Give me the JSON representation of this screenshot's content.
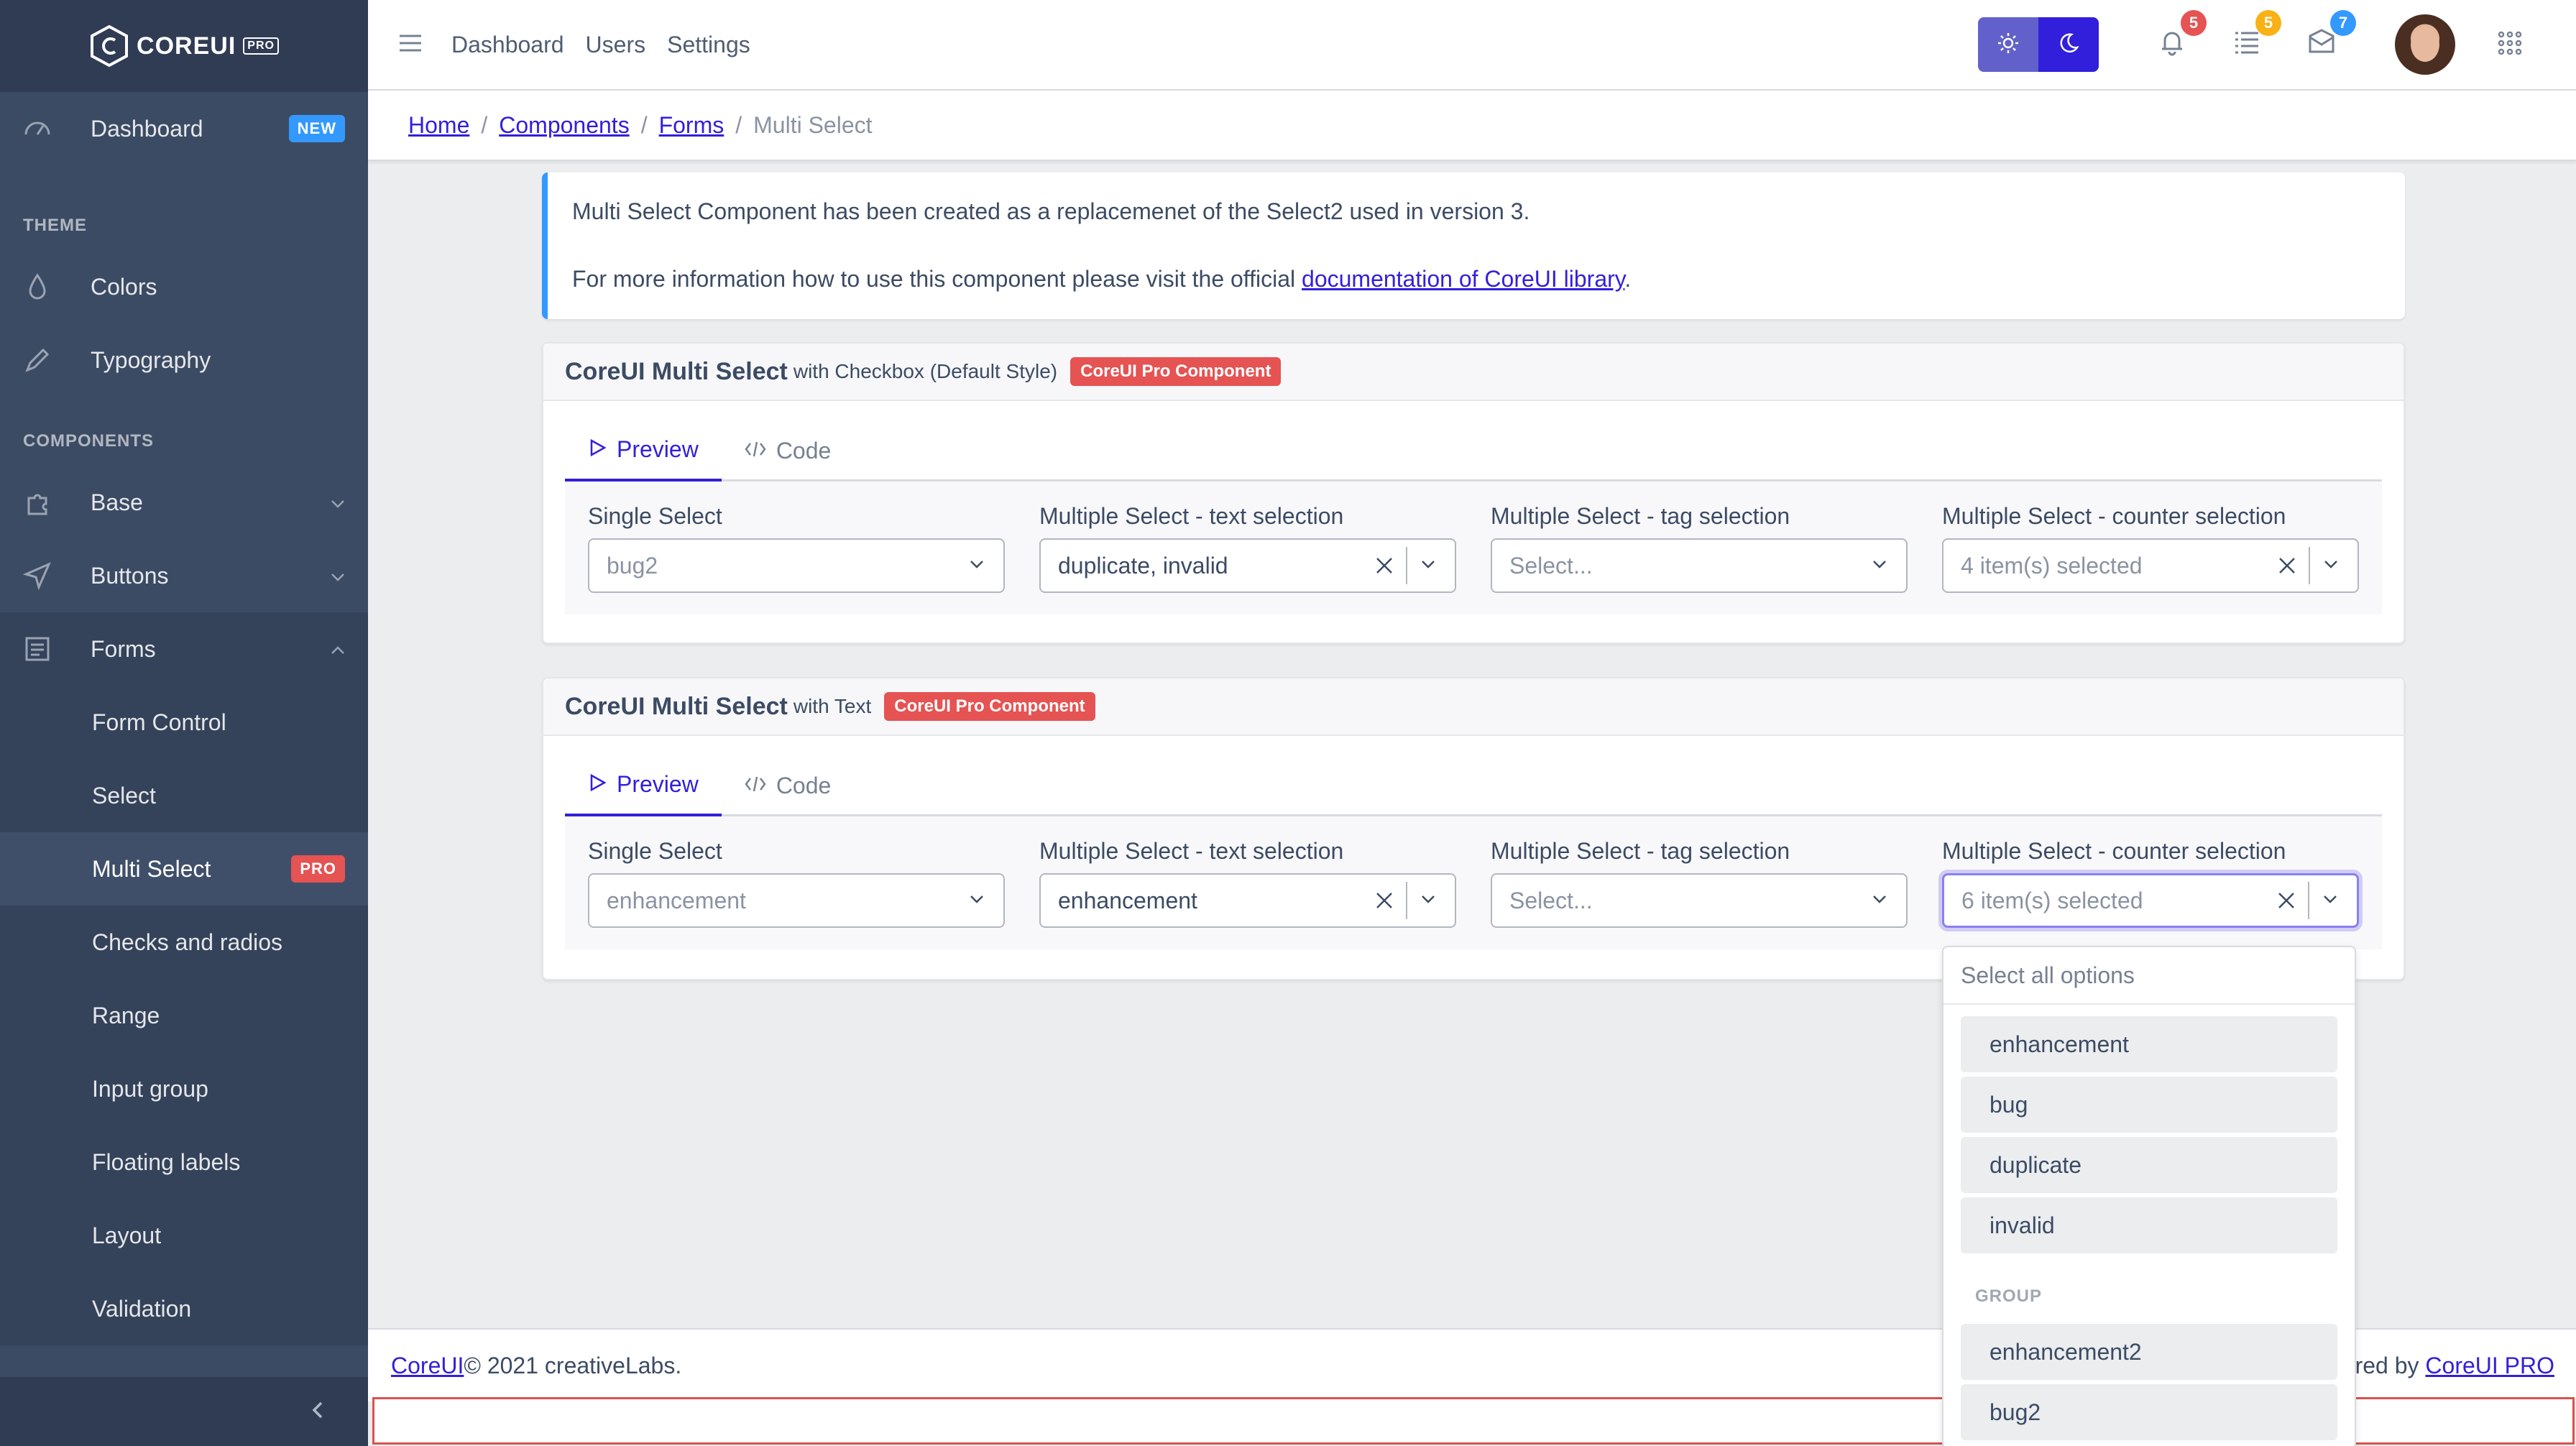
{
  "brand": {
    "name": "COREUI",
    "badge": "PRO"
  },
  "sidebar": {
    "dashboard": {
      "label": "Dashboard",
      "badge": "NEW"
    },
    "theme_title": "THEME",
    "colors": "Colors",
    "typography": "Typography",
    "components_title": "COMPONENTS",
    "base": "Base",
    "buttons": "Buttons",
    "forms": "Forms",
    "sub": [
      "Form Control",
      "Select",
      "Multi Select",
      "Checks and radios",
      "Range",
      "Input group",
      "Floating labels",
      "Layout",
      "Validation"
    ],
    "multi_badge": "PRO"
  },
  "header": {
    "nav": [
      "Dashboard",
      "Users",
      "Settings"
    ],
    "notif_count": "5",
    "tasks_count": "5",
    "messages_count": "7"
  },
  "breadcrumb": {
    "home": "Home",
    "components": "Components",
    "forms": "Forms",
    "current": "Multi Select"
  },
  "callout": {
    "line1": "Multi Select Component has been created as a replacemenet of the Select2 used in version 3.",
    "line2_pre": "For more information how to use this component please visit the official ",
    "line2_link": "documentation of CoreUI library",
    "line2_post": "."
  },
  "card1": {
    "title": "CoreUI Multi Select",
    "subtitle": "with Checkbox (Default Style)",
    "badge": "CoreUI Pro Component",
    "tab_preview": "Preview",
    "tab_code": "Code",
    "fields": [
      {
        "label": "Single Select",
        "value": "bug2"
      },
      {
        "label": "Multiple Select - text selection",
        "value": "duplicate, invalid"
      },
      {
        "label": "Multiple Select - tag selection",
        "value": "Select..."
      },
      {
        "label": "Multiple Select - counter selection",
        "value": "4 item(s) selected"
      }
    ]
  },
  "card2": {
    "title": "CoreUI Multi Select",
    "subtitle": "with Text",
    "badge": "CoreUI Pro Component",
    "tab_preview": "Preview",
    "tab_code": "Code",
    "fields": [
      {
        "label": "Single Select",
        "value": "enhancement"
      },
      {
        "label": "Multiple Select - text selection",
        "value": "enhancement"
      },
      {
        "label": "Multiple Select - tag selection",
        "value": "Select..."
      },
      {
        "label": "Multiple Select - counter selection",
        "value": "6 item(s) selected"
      }
    ]
  },
  "dropdown": {
    "select_all": "Select all options",
    "options": [
      "enhancement",
      "bug",
      "duplicate",
      "invalid"
    ],
    "group_label": "GROUP",
    "group_options": [
      "enhancement2",
      "bug2"
    ]
  },
  "footer": {
    "brand": "CoreUI",
    "copyright": " © 2021 creativeLabs.",
    "right_pre": "red by ",
    "right_link": "CoreUI PRO"
  },
  "colors": {
    "primary": "#321fdb",
    "sidebar": "#3c4b64",
    "danger": "#e55353",
    "info": "#39f",
    "warning": "#f9b115"
  }
}
